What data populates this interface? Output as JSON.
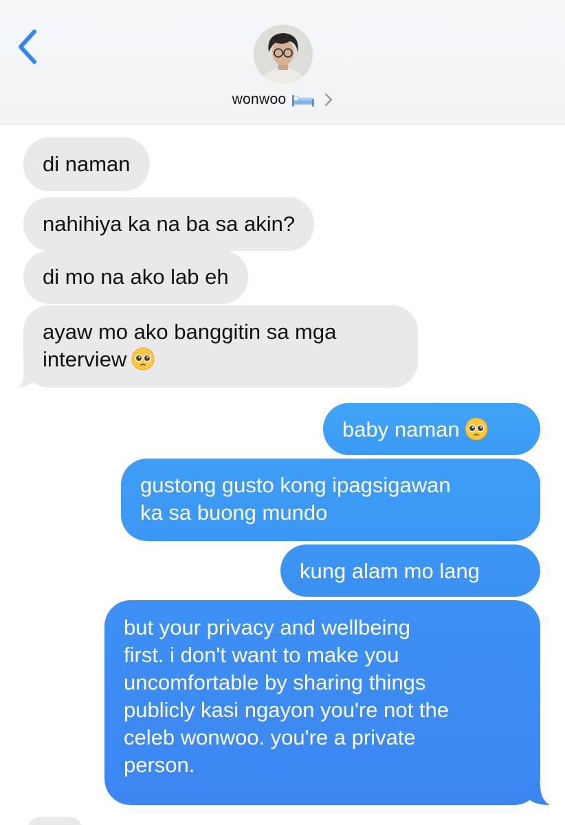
{
  "header": {
    "back_icon": "chevron-left-icon",
    "contact_name": "wonwoo",
    "contact_emoji": "bed-emoji",
    "chevron": "chevron-right-icon"
  },
  "colors": {
    "incoming_bubble": "#e9e9eb",
    "outgoing_top": "#3c9ff5",
    "outgoing_bottom": "#3c86f2",
    "accent": "#2f86f6"
  },
  "messages": [
    {
      "direction": "incoming",
      "lines": [
        "di naman"
      ]
    },
    {
      "direction": "incoming",
      "lines": [
        "nahihiya ka na ba sa akin?"
      ]
    },
    {
      "direction": "incoming",
      "lines": [
        "di mo na ako lab eh"
      ]
    },
    {
      "direction": "incoming",
      "lines": [
        "ayaw mo ako banggitin sa mga",
        "interview"
      ],
      "emoji": "pleading-face-emoji"
    },
    {
      "direction": "outgoing",
      "lines": [
        "baby naman"
      ],
      "emoji": "pleading-face-emoji"
    },
    {
      "direction": "outgoing",
      "lines": [
        "gustong gusto kong ipagsigawan",
        "ka sa buong mundo"
      ]
    },
    {
      "direction": "outgoing",
      "lines": [
        "kung alam mo lang"
      ]
    },
    {
      "direction": "outgoing",
      "lines": [
        "but your privacy and wellbeing",
        "first. i don't want to make you",
        "uncomfortable by sharing things",
        "publicly kasi ngayon you're not the",
        "celeb wonwoo. you're a private",
        "person."
      ]
    }
  ]
}
